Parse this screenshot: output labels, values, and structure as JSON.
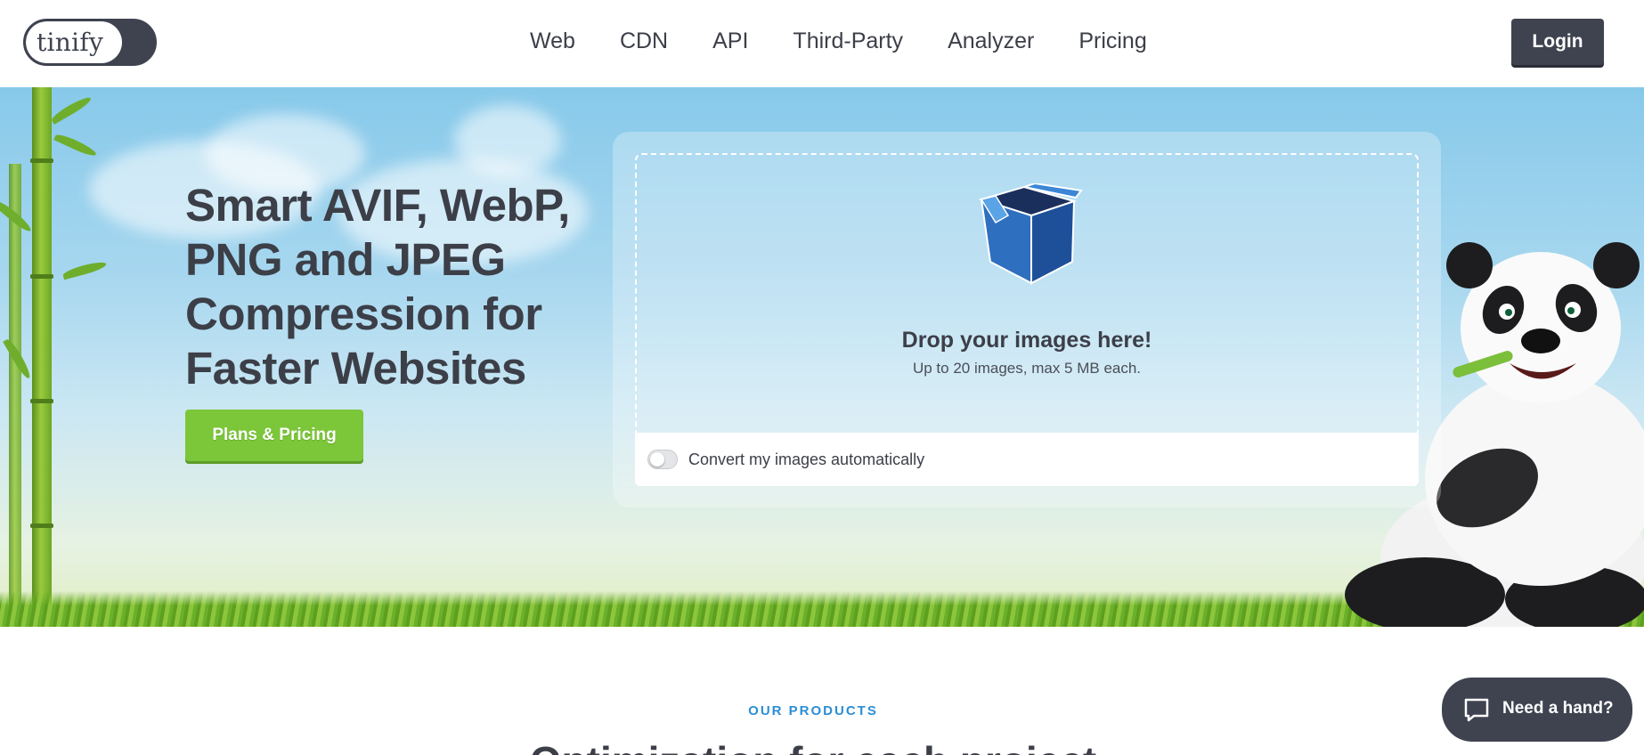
{
  "header": {
    "logo_text": "tinify",
    "nav": [
      "Web",
      "CDN",
      "API",
      "Third-Party",
      "Analyzer",
      "Pricing"
    ],
    "login_label": "Login"
  },
  "hero": {
    "headline": "Smart AVIF, WebP, PNG and JPEG Compression for Faster Websites",
    "plans_button": "Plans & Pricing",
    "drop_title": "Drop your images here!",
    "drop_subtitle": "Up to 20 images, max 5 MB each.",
    "convert_label": "Convert my images automatically",
    "convert_enabled": false
  },
  "products": {
    "label": "OUR PRODUCTS",
    "heading": "Optimization for each project"
  },
  "help": {
    "label": "Need a hand?"
  },
  "colors": {
    "dark": "#3f4350",
    "green": "#7bc639",
    "accent_blue": "#2b8ed6"
  },
  "icons": [
    "box-icon",
    "chat-icon",
    "panda-mascot",
    "toggle-switch"
  ]
}
